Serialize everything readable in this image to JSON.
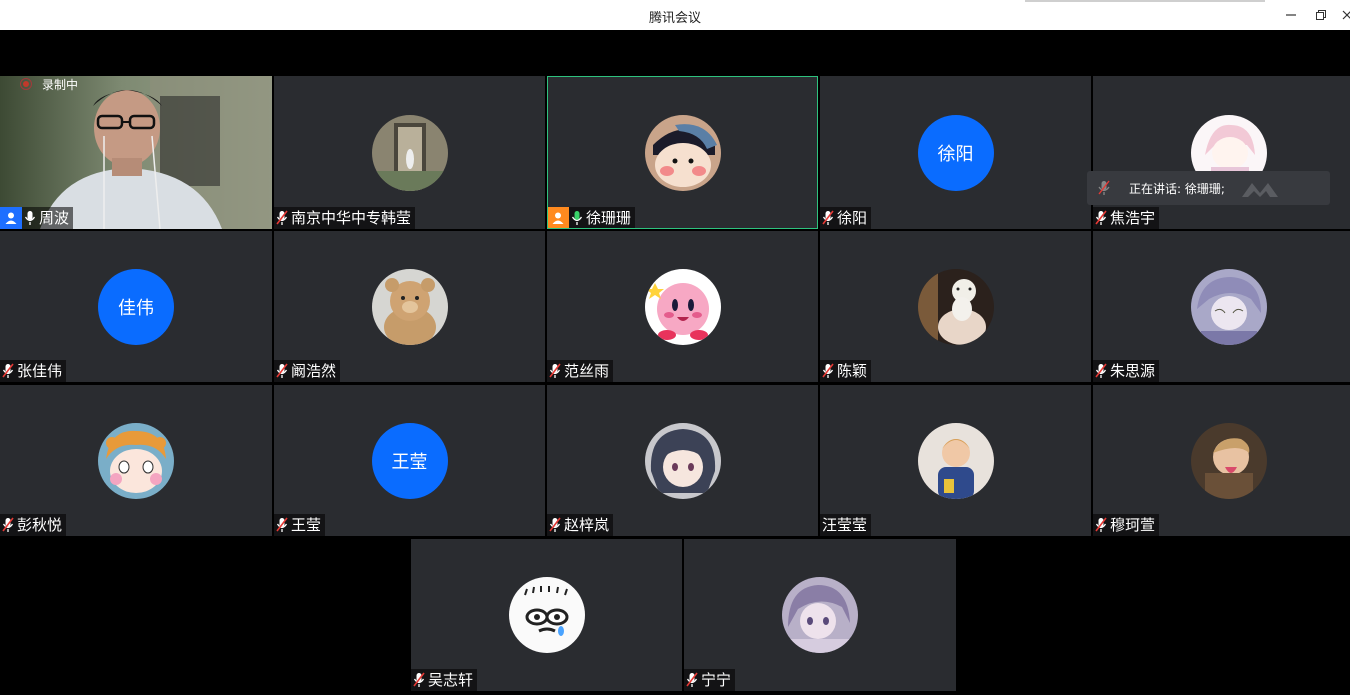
{
  "window": {
    "title": "腾讯会议"
  },
  "recording": {
    "label": "录制中"
  },
  "speaking": {
    "label": "正在讲话: 徐珊珊;"
  },
  "colors": {
    "avatar_blue": "#0a6cff",
    "active_border": "#2ec27e",
    "tile_bg": "#2a2c30",
    "host_orange": "#ff8a1f",
    "cohost_blue": "#1e6fff"
  },
  "participants": [
    {
      "name": "周波",
      "avatar": "camera-video"
    },
    {
      "name": "南京中华中专韩莹",
      "avatar": "photo-doorway"
    },
    {
      "name": "徐珊珊",
      "avatar": "photo-cartoon-girl"
    },
    {
      "name": "徐阳",
      "avatar_text": "徐阳"
    },
    {
      "name": "焦浩宇",
      "avatar": "photo-anime-pink"
    },
    {
      "name": "张佳伟",
      "avatar_text": "佳伟"
    },
    {
      "name": "阚浩然",
      "avatar": "photo-teddy-bear"
    },
    {
      "name": "范丝雨",
      "avatar": "photo-kirby"
    },
    {
      "name": "陈颖",
      "avatar": "photo-person-cat"
    },
    {
      "name": "朱思源",
      "avatar": "photo-anime-purple"
    },
    {
      "name": "彭秋悦",
      "avatar": "photo-cartoon-face"
    },
    {
      "name": "王莹",
      "avatar_text": "王莹"
    },
    {
      "name": "赵梓岚",
      "avatar": "photo-anime-bluehair"
    },
    {
      "name": "汪莹莹",
      "avatar": "photo-child"
    },
    {
      "name": "穆珂萱",
      "avatar": "photo-kid-tongue"
    },
    {
      "name": "吴志轩",
      "avatar": "photo-meme-face"
    },
    {
      "name": "宁宁",
      "avatar": "photo-anime-lavender"
    }
  ]
}
